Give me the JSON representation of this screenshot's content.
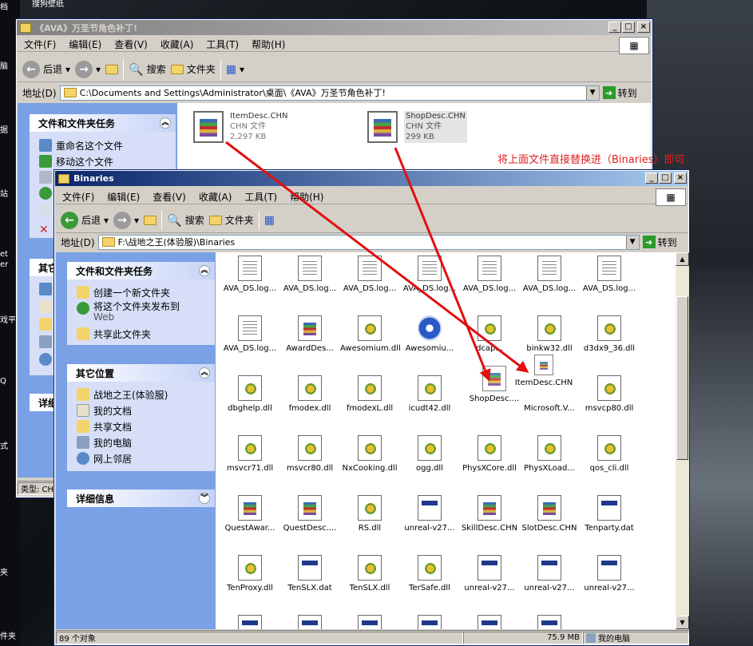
{
  "desktop": {
    "top_label": "搜狗壁纸",
    "items": [
      "档",
      "脑",
      "据",
      "站",
      "et",
      "er",
      "戏平",
      "Q",
      "式",
      "夹",
      "件夹"
    ]
  },
  "back_window": {
    "title": "《AVA》万圣节角色补丁!",
    "menu": [
      "文件(F)",
      "编辑(E)",
      "查看(V)",
      "收藏(A)",
      "工具(T)",
      "帮助(H)"
    ],
    "toolbar": {
      "back": "后退",
      "search": "搜索",
      "folders": "文件夹"
    },
    "address_label": "地址(D)",
    "address_path": "C:\\Documents and Settings\\Administrator\\桌面\\《AVA》万圣节角色补丁!",
    "go": "转到",
    "tasks_title": "文件和文件夹任务",
    "tasks": [
      "重命名这个文件",
      "移动这个文件"
    ],
    "other_partial": "其它",
    "details_partial": "详细",
    "status_partial": "类型: CH",
    "files": [
      {
        "name": "ItemDesc.CHN",
        "type": "CHN 文件",
        "size": "2,297 KB"
      },
      {
        "name": "ShopDesc.CHN",
        "type": "CHN 文件",
        "size": "299 KB"
      }
    ]
  },
  "annotation": "将上面文件直接替换进（Binaries）即可",
  "front_window": {
    "title": "Binaries",
    "menu": [
      "文件(F)",
      "编辑(E)",
      "查看(V)",
      "收藏(A)",
      "工具(T)",
      "帮助(H)"
    ],
    "toolbar": {
      "back": "后退",
      "search": "搜索",
      "folders": "文件夹"
    },
    "address_label": "地址(D)",
    "address_path": "F:\\战地之王(体验服)\\Binaries",
    "go": "转到",
    "tasks": {
      "title": "文件和文件夹任务",
      "items": [
        "创建一个新文件夹",
        "将这个文件夹发布到",
        "Web",
        "共享此文件夹"
      ]
    },
    "places": {
      "title": "其它位置",
      "items": [
        "战地之王(体验服)",
        "我的文档",
        "共享文档",
        "我的电脑",
        "网上邻居"
      ]
    },
    "details": {
      "title": "详细信息"
    },
    "files": [
      {
        "name": "AVA_DS.log...",
        "icon": "doc"
      },
      {
        "name": "AVA_DS.log...",
        "icon": "doc"
      },
      {
        "name": "AVA_DS.log...",
        "icon": "doc"
      },
      {
        "name": "AVA_DS.log...",
        "icon": "doc"
      },
      {
        "name": "AVA_DS.log...",
        "icon": "doc"
      },
      {
        "name": "AVA_DS.log...",
        "icon": "doc"
      },
      {
        "name": "AVA_DS.log...",
        "icon": "doc"
      },
      {
        "name": "AVA_DS.log...",
        "icon": "doc"
      },
      {
        "name": "AwardDes...",
        "icon": "rar"
      },
      {
        "name": "Awesomium.dll",
        "icon": "dll"
      },
      {
        "name": "Awesomiu...",
        "icon": "blue"
      },
      {
        "name": "dcap...",
        "icon": "dll"
      },
      {
        "name": "binkw32.dll",
        "icon": "dll"
      },
      {
        "name": "d3dx9_36.dll",
        "icon": "dll"
      },
      {
        "name": "dbghelp.dll",
        "icon": "dll"
      },
      {
        "name": "fmodex.dll",
        "icon": "dll"
      },
      {
        "name": "fmodexL.dll",
        "icon": "dll"
      },
      {
        "name": "icudt42.dll",
        "icon": "dll"
      },
      {
        "name": "",
        "icon": "none"
      },
      {
        "name": "Microsoft.V...",
        "icon": "none"
      },
      {
        "name": "msvcp80.dll",
        "icon": "dll"
      },
      {
        "name": "msvcr71.dll",
        "icon": "dll"
      },
      {
        "name": "msvcr80.dll",
        "icon": "dll"
      },
      {
        "name": "NxCooking.dll",
        "icon": "dll"
      },
      {
        "name": "ogg.dll",
        "icon": "dll"
      },
      {
        "name": "PhysXCore.dll",
        "icon": "dll"
      },
      {
        "name": "PhysXLoad...",
        "icon": "dll"
      },
      {
        "name": "qos_cli.dll",
        "icon": "dll"
      },
      {
        "name": "QuestAwar...",
        "icon": "rar"
      },
      {
        "name": "QuestDesc....",
        "icon": "rar"
      },
      {
        "name": "RS.dll",
        "icon": "dll"
      },
      {
        "name": "unreal-v27...",
        "icon": "exe"
      },
      {
        "name": "SkillDesc.CHN",
        "icon": "rar"
      },
      {
        "name": "SlotDesc.CHN",
        "icon": "rar"
      },
      {
        "name": "Tenparty.dat",
        "icon": "exe"
      },
      {
        "name": "TenProxy.dll",
        "icon": "dll"
      },
      {
        "name": "TenSLX.dat",
        "icon": "exe"
      },
      {
        "name": "TenSLX.dll",
        "icon": "dll"
      },
      {
        "name": "TerSafe.dll",
        "icon": "dll"
      },
      {
        "name": "unreal-v27...",
        "icon": "exe"
      },
      {
        "name": "unreal-v27...",
        "icon": "exe"
      },
      {
        "name": "unreal-v27...",
        "icon": "exe"
      }
    ],
    "dragged": [
      {
        "name": "ShopDesc...."
      },
      {
        "name": "ItemDesc.CHN"
      }
    ],
    "status": {
      "count": "89 个对象",
      "size": "75.9 MB",
      "location": "我的电脑"
    }
  }
}
